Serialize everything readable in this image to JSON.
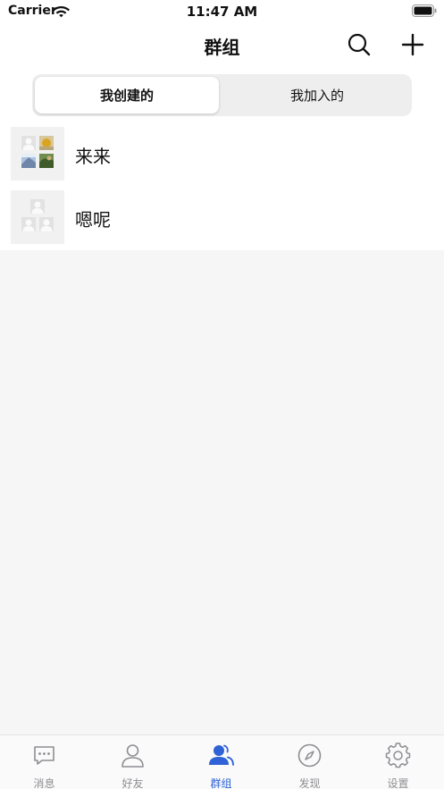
{
  "status_bar": {
    "carrier": "Carrier",
    "time": "11:47 AM"
  },
  "nav": {
    "title": "群组"
  },
  "segments": {
    "created": "我创建的",
    "joined": "我加入的"
  },
  "groups": [
    {
      "name": "来来"
    },
    {
      "name": "嗯呢"
    }
  ],
  "tabs": [
    {
      "label": "消息"
    },
    {
      "label": "好友"
    },
    {
      "label": "群组"
    },
    {
      "label": "发现"
    },
    {
      "label": "设置"
    }
  ],
  "colors": {
    "accent": "#2f62d6",
    "inactive": "#8e8e93",
    "background": "#f6f6f6"
  }
}
